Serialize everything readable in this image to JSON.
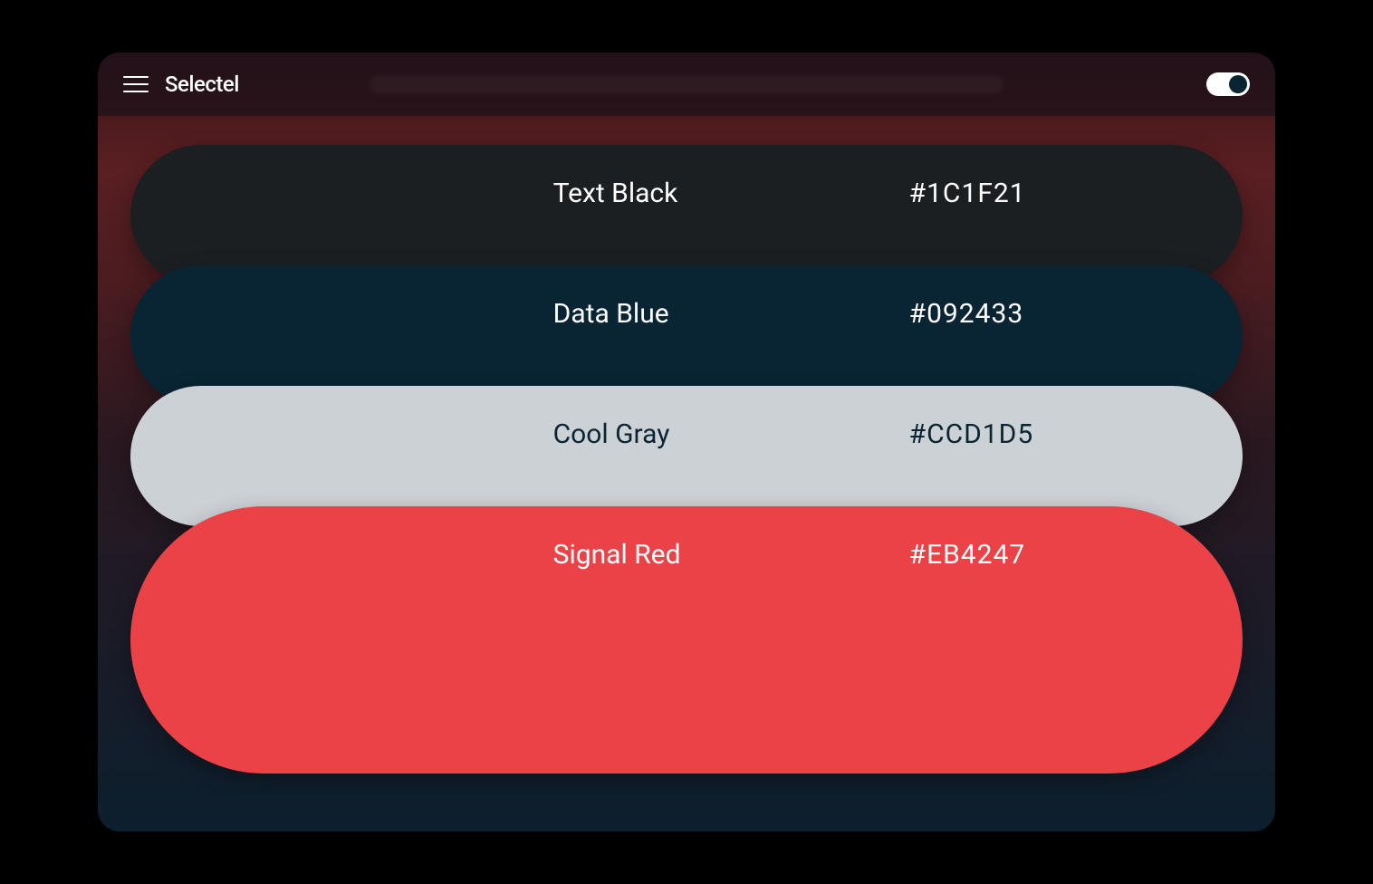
{
  "header": {
    "brand": "Selectel",
    "toggle_on": true
  },
  "colors": [
    {
      "name": "Text Black",
      "hex": "#1C1F21",
      "class": "pill-black"
    },
    {
      "name": "Data Blue",
      "hex": "#092433",
      "class": "pill-blue"
    },
    {
      "name": "Cool Gray",
      "hex": "#CCD1D5",
      "class": "pill-gray"
    },
    {
      "name": "Signal Red",
      "hex": "#EB4247",
      "class": "pill-red"
    }
  ]
}
